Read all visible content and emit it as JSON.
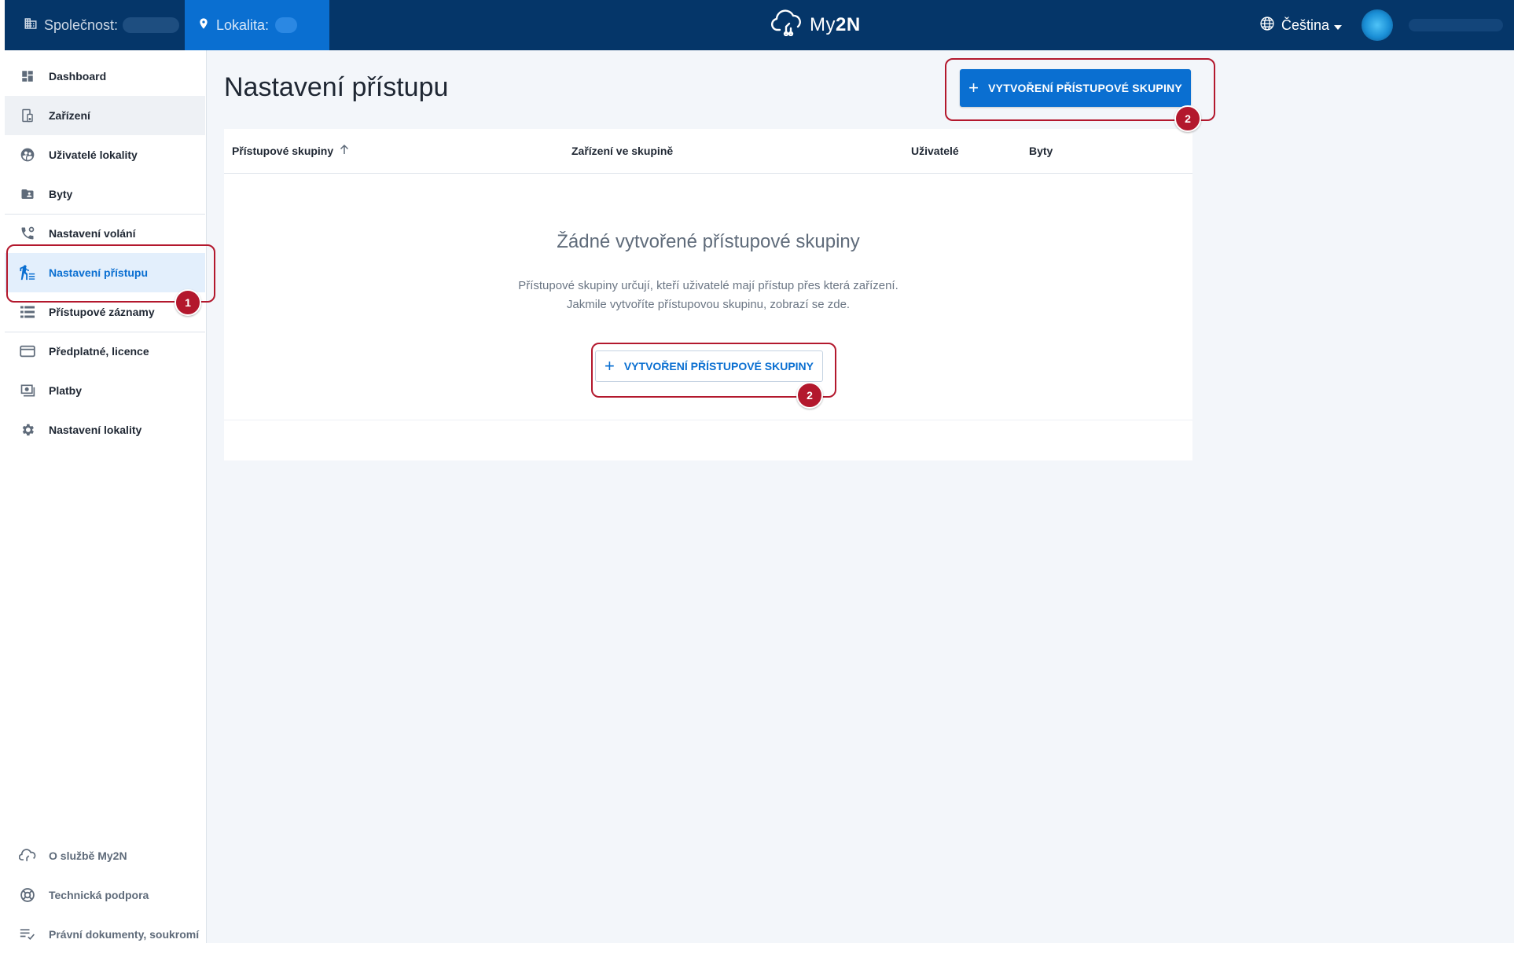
{
  "header": {
    "company_label": "Společnost:",
    "location_label": "Lokalita:",
    "logo_text": "My",
    "logo_bold": "2N",
    "language": "Čeština"
  },
  "sidebar": {
    "items": [
      {
        "label": "Dashboard",
        "icon": "dashboard-icon"
      },
      {
        "label": "Zařízení",
        "icon": "device-icon"
      },
      {
        "label": "Uživatelé lokality",
        "icon": "users-icon"
      },
      {
        "label": "Byty",
        "icon": "apartment-icon"
      },
      {
        "label": "Nastavení volání",
        "icon": "call-settings-icon"
      },
      {
        "label": "Nastavení přístupu",
        "icon": "access-icon"
      },
      {
        "label": "Přístupové záznamy",
        "icon": "access-log-icon"
      },
      {
        "label": "Předplatné, licence",
        "icon": "card-icon"
      },
      {
        "label": "Platby",
        "icon": "payments-icon"
      },
      {
        "label": "Nastavení lokality",
        "icon": "gear-icon"
      }
    ],
    "footer_items": [
      {
        "label": "O službě My2N",
        "icon": "cloud-icon"
      },
      {
        "label": "Technická podpora",
        "icon": "support-icon"
      },
      {
        "label": "Právní dokumenty, soukromí",
        "icon": "list-check-icon"
      }
    ],
    "active_item": "Nastavení přístupu"
  },
  "main": {
    "title": "Nastavení přístupu",
    "create_button_label": "VYTVOŘENÍ PŘÍSTUPOVÉ SKUPINY",
    "table": {
      "columns": [
        "Přístupové skupiny",
        "Zařízení ve skupině",
        "Uživatelé",
        "Byty"
      ]
    },
    "empty": {
      "title": "Žádné vytvořené přístupové skupiny",
      "line1": "Přístupové skupiny určují, kteří uživatelé mají přístup přes která zařízení.",
      "line2": "Jakmile vytvoříte přístupovou skupinu, zobrazí se zde.",
      "button_label": "VYTVOŘENÍ PŘÍSTUPOVÉ SKUPINY"
    }
  },
  "callouts": {
    "one": "1",
    "two": "2"
  },
  "colors": {
    "header_bg": "#053669",
    "accent": "#0a6fd1",
    "callout": "#b3182d"
  }
}
